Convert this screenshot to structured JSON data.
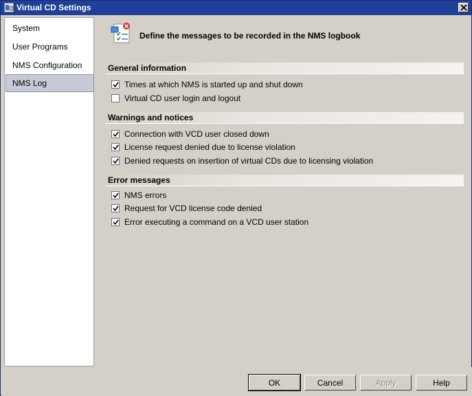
{
  "window": {
    "title": "Virtual CD Settings"
  },
  "nav": {
    "items": [
      {
        "label": "System"
      },
      {
        "label": "User Programs"
      },
      {
        "label": "NMS Configuration"
      },
      {
        "label": "NMS Log",
        "selected": true
      }
    ]
  },
  "header": {
    "text": "Define the messages to be recorded in the NMS logbook"
  },
  "sections": {
    "general": {
      "title": "General information",
      "options": [
        {
          "label": "Times at which NMS is started up and shut down",
          "checked": true
        },
        {
          "label": "Virtual CD user login and logout",
          "checked": false
        }
      ]
    },
    "warnings": {
      "title": "Warnings and notices",
      "options": [
        {
          "label": "Connection with VCD user closed down",
          "checked": true
        },
        {
          "label": "License request denied due to license violation",
          "checked": true
        },
        {
          "label": "Denied requests on insertion of virtual CDs due to licensing violation",
          "checked": true
        }
      ]
    },
    "errors": {
      "title": "Error messages",
      "options": [
        {
          "label": "NMS errors",
          "checked": true
        },
        {
          "label": "Request for VCD license code denied",
          "checked": true
        },
        {
          "label": "Error executing a command on a VCD user station",
          "checked": true
        }
      ]
    }
  },
  "buttons": {
    "ok": "OK",
    "cancel": "Cancel",
    "apply": "Apply",
    "help": "Help"
  },
  "colors": {
    "titlebar": "#1f3f98",
    "dialog_bg": "#d4d0c8",
    "selected_nav": "#c7cbd6"
  }
}
